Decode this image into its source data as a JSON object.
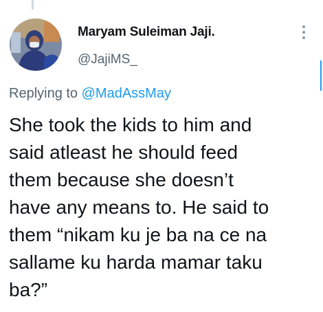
{
  "author": {
    "display_name": "Maryam Suleiman Jaji.",
    "handle": "@JajiMS_",
    "avatar_icon": "person-avatar"
  },
  "reply": {
    "prefix": "Replying to",
    "mention": "@MadAssMay"
  },
  "tweet": {
    "lines": [
      "She took the kids to him and",
      "said atleast he should feed",
      "them because she doesn’t",
      "have any means to. He said to",
      "them “nikam ku je ba na ce na",
      "sallame ku harda mamar taku",
      "ba?”"
    ]
  },
  "colors": {
    "text": "#0f1419",
    "secondary": "#536471",
    "link": "#1d9bf0"
  }
}
